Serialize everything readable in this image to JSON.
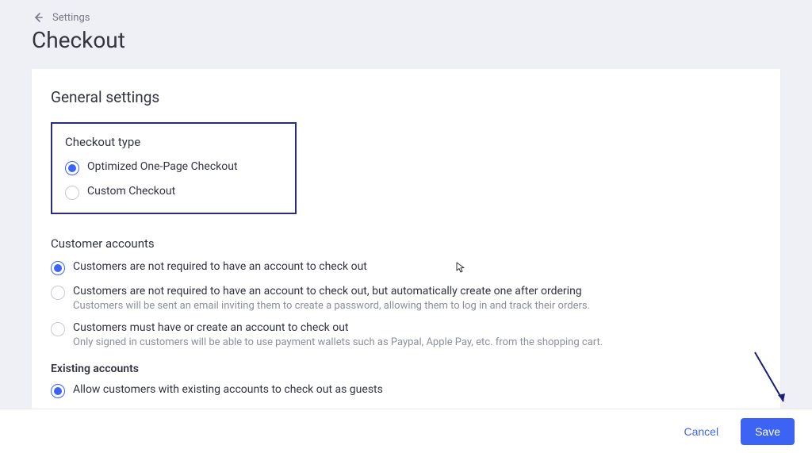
{
  "breadcrumb": {
    "label": "Settings"
  },
  "page": {
    "title": "Checkout"
  },
  "general": {
    "heading": "General settings",
    "checkout_type": {
      "heading": "Checkout type",
      "options": [
        {
          "label": "Optimized One-Page Checkout",
          "selected": true
        },
        {
          "label": "Custom Checkout",
          "selected": false
        }
      ]
    },
    "customer_accounts": {
      "heading": "Customer accounts",
      "options": [
        {
          "label": "Customers are not required to have an account to check out",
          "sub": null,
          "selected": true
        },
        {
          "label": "Customers are not required to have an account to check out, but automatically create one after ordering",
          "sub": "Customers will be sent an email inviting them to create a password, allowing them to log in and track their orders.",
          "selected": false
        },
        {
          "label": "Customers must have or create an account to check out",
          "sub": "Only signed in customers will be able to use payment wallets such as Paypal, Apple Pay, etc. from the shopping cart.",
          "selected": false
        }
      ]
    },
    "existing_accounts": {
      "heading": "Existing accounts",
      "options": [
        {
          "label": "Allow customers with existing accounts to check out as guests",
          "selected": true
        }
      ]
    }
  },
  "footer": {
    "cancel": "Cancel",
    "save": "Save"
  }
}
